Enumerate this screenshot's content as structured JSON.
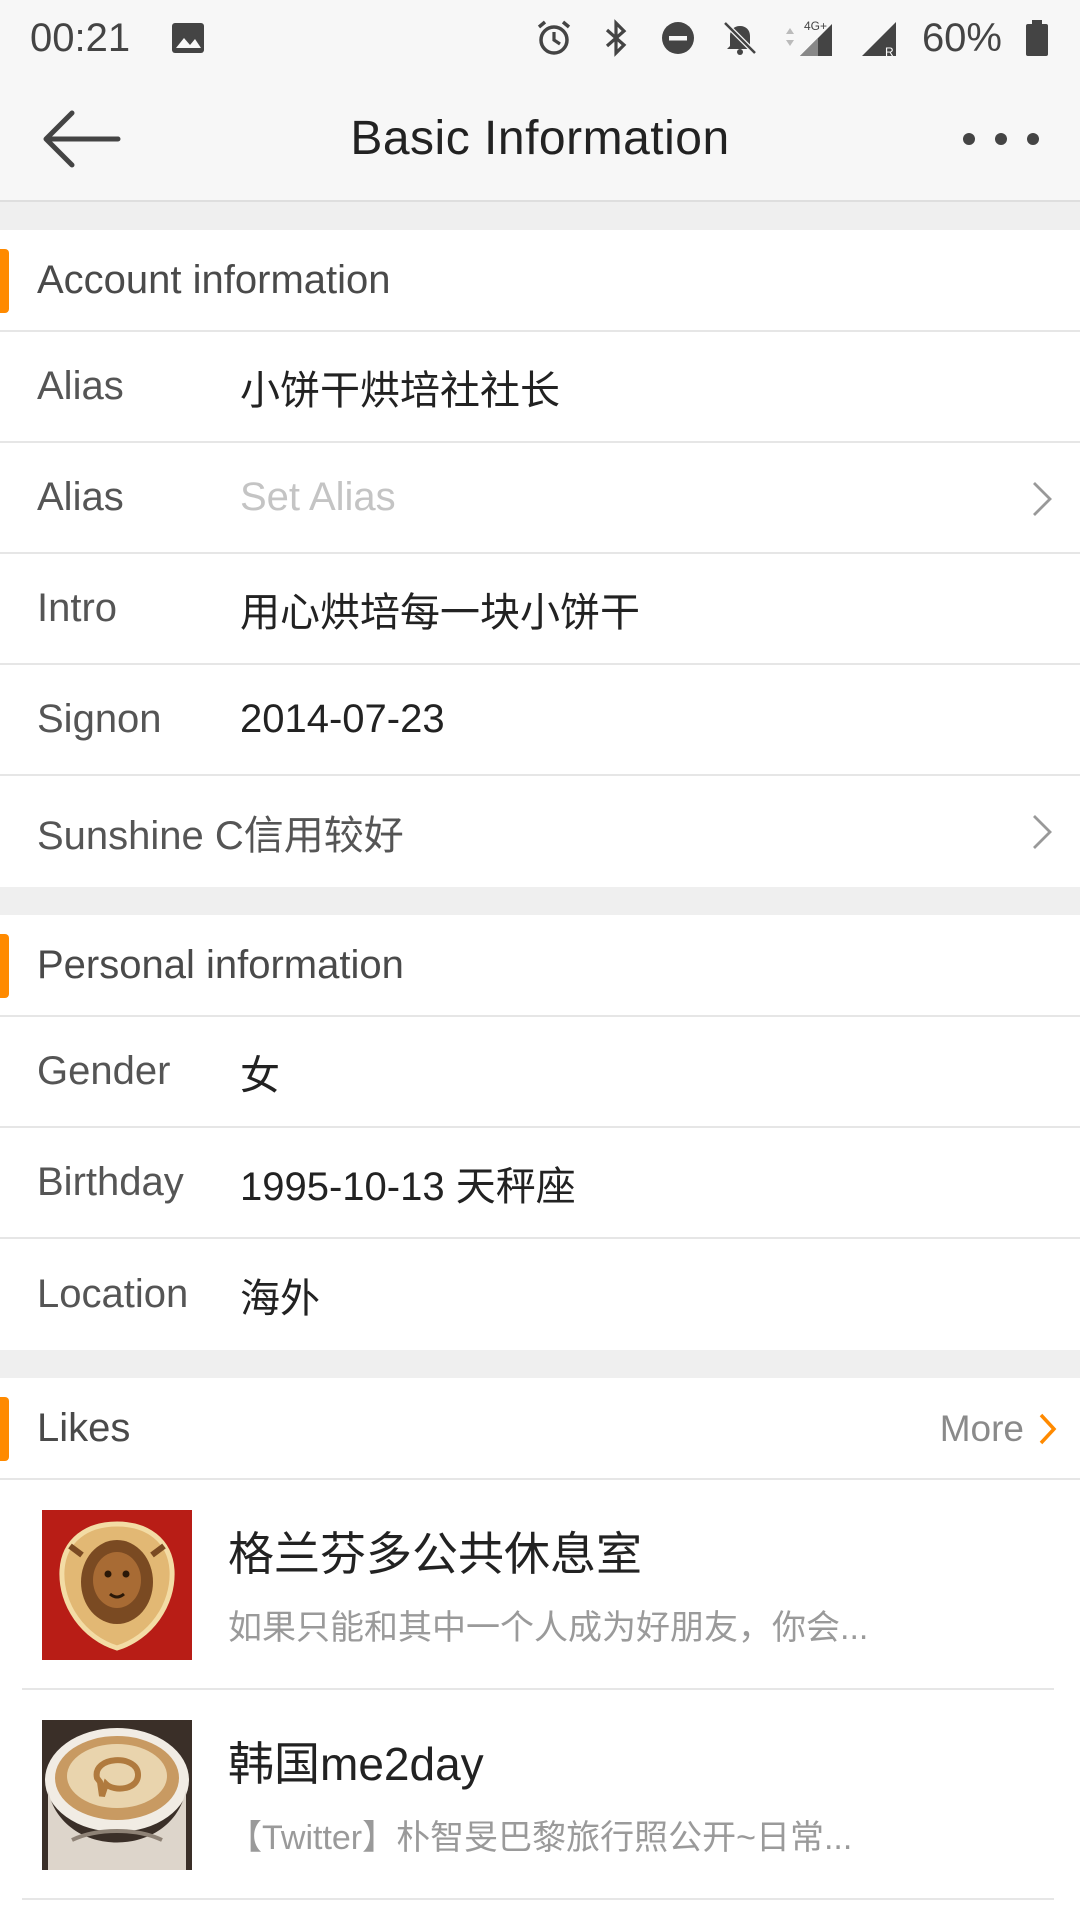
{
  "status_bar": {
    "time": "00:21",
    "battery": "60%",
    "network": "4G+"
  },
  "header": {
    "title": "Basic Information",
    "back_icon": "arrow-left-icon",
    "more_icon": "more-horizontal-icon"
  },
  "accent_color": "#ff8a00",
  "account": {
    "section_title": "Account information",
    "rows": [
      {
        "label": "Alias",
        "value": "小饼干烘培社社长"
      },
      {
        "label": "Alias",
        "value": "Set Alias"
      },
      {
        "label": "Intro",
        "value": "用心烘培每一块小饼干"
      },
      {
        "label": "Signon",
        "value": "2014-07-23"
      },
      {
        "label": "Sunshine C信用较好"
      }
    ]
  },
  "personal": {
    "section_title": "Personal information",
    "rows": [
      {
        "label": "Gender",
        "value": "女"
      },
      {
        "label": "Birthday",
        "value": "1995-10-13 天秤座"
      },
      {
        "label": "Location",
        "value": "海外"
      }
    ]
  },
  "likes": {
    "section_title": "Likes",
    "more_label": "More",
    "items": [
      {
        "title": "格兰芬多公共休息室",
        "desc": "如果只能和其中一个人成为好朋友，你会..."
      },
      {
        "title": "韩国me2day",
        "desc": "【Twitter】朴智旻巴黎旅行照公开~日常..."
      }
    ]
  }
}
